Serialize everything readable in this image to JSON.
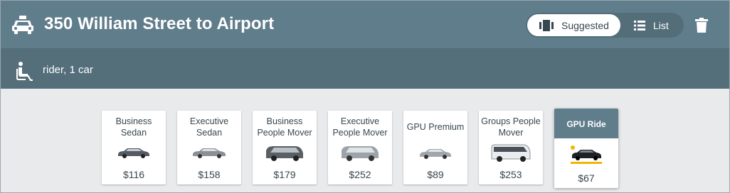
{
  "header": {
    "title": "350 William Street to Airport",
    "view_toggle": {
      "suggested_label": "Suggested",
      "list_label": "List",
      "selected": "Suggested"
    },
    "icons": [
      "taxi-icon",
      "carousel-icon",
      "list-icon",
      "trash-icon"
    ]
  },
  "subheader": {
    "rider_text": "rider, 1 car",
    "icon": "seat-icon"
  },
  "vehicles": [
    {
      "name": "Business Sedan",
      "price": "$116"
    },
    {
      "name": "Executive Sedan",
      "price": "$158"
    },
    {
      "name": "Business People Mover",
      "price": "$179"
    },
    {
      "name": "Executive People Mover",
      "price": "$252"
    },
    {
      "name": "GPU Premium",
      "price": "$89"
    },
    {
      "name": "Groups People Mover",
      "price": "$253"
    },
    {
      "name": "GPU Ride",
      "price": "$67",
      "selected": true
    }
  ],
  "colors": {
    "header": "#607d8b",
    "subheader": "#546e7a",
    "background": "#e9eaec",
    "accent": "#f5b400"
  }
}
